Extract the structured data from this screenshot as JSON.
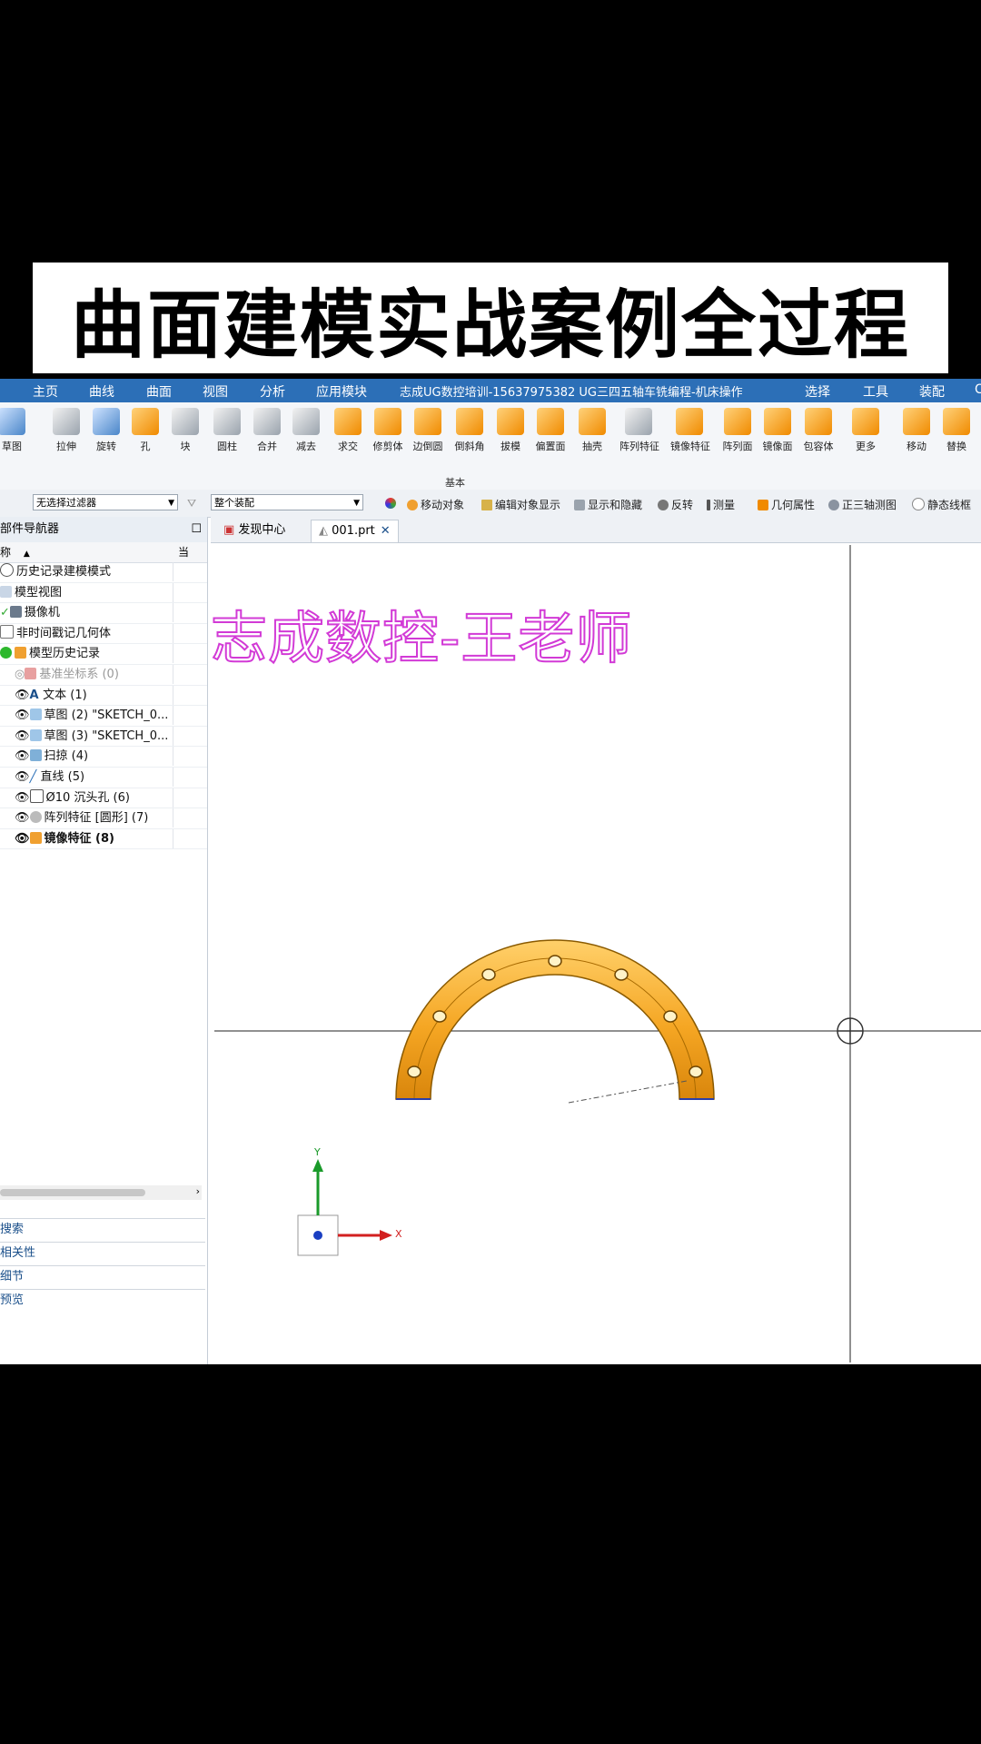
{
  "banner": {
    "title": "曲面建模实战案例全过程"
  },
  "menubar": {
    "items": [
      "主页",
      "曲线",
      "曲面",
      "视图",
      "分析",
      "应用模块",
      "志成UG数控培训-15637975382  UG三四五轴车铣编程-机床操作",
      "选择",
      "工具",
      "装配",
      "C"
    ],
    "active": "主页"
  },
  "ribbon": {
    "tools": [
      "草图",
      "拉伸",
      "旋转",
      "孔",
      "块",
      "圆柱",
      "合并",
      "减去",
      "求交",
      "修剪体",
      "边倒圆",
      "倒斜角",
      "拔模",
      "偏置面",
      "抽壳",
      "阵列特征",
      "镜像特征",
      "阵列面",
      "镜像面",
      "包容体",
      "更多",
      "移动",
      "替换"
    ],
    "group_label": "基本"
  },
  "filterbar": {
    "filter_select": "无选择过滤器",
    "scope_select": "整个装配",
    "buttons": [
      "移动对象",
      "编辑对象显示",
      "显示和隐藏",
      "反转",
      "测量",
      "几何属性",
      "正三轴测图",
      "静态线框"
    ]
  },
  "navigator": {
    "title": "部件导航器",
    "column_header": "称",
    "column_header2": "当",
    "rows": [
      {
        "label": "历史记录建模模式",
        "icon": "clock-icon"
      },
      {
        "label": "模型视图",
        "icon": "views-icon"
      },
      {
        "label": "摄像机",
        "icon": "camera-icon"
      },
      {
        "label": "非时间戳记几何体",
        "icon": "folder-icon"
      },
      {
        "label": "模型历史记录",
        "icon": "history-icon"
      },
      {
        "label": "基准坐标系 (0)",
        "icon": "csys-icon"
      },
      {
        "label": "文本 (1)",
        "icon": "text-icon"
      },
      {
        "label": "草图 (2) \"SKETCH_0...",
        "icon": "sketch-icon"
      },
      {
        "label": "草图 (3) \"SKETCH_0...",
        "icon": "sketch-icon"
      },
      {
        "label": "扫掠 (4)",
        "icon": "sweep-icon"
      },
      {
        "label": "直线 (5)",
        "icon": "line-icon"
      },
      {
        "label": "Ø10 沉头孔 (6)",
        "icon": "hole-icon"
      },
      {
        "label": "阵列特征 [圆形] (7)",
        "icon": "pattern-icon"
      },
      {
        "label": "镜像特征 (8)",
        "icon": "mirror-icon"
      }
    ],
    "panels": [
      "搜索",
      "相关性",
      "细节",
      "预览"
    ]
  },
  "tabs": [
    "发现中心",
    "001.prt"
  ],
  "viewport": {
    "watermark": "志成数控-王老师",
    "triad": {
      "y": "Y",
      "x": "X"
    },
    "part_color": "#f5a623"
  }
}
